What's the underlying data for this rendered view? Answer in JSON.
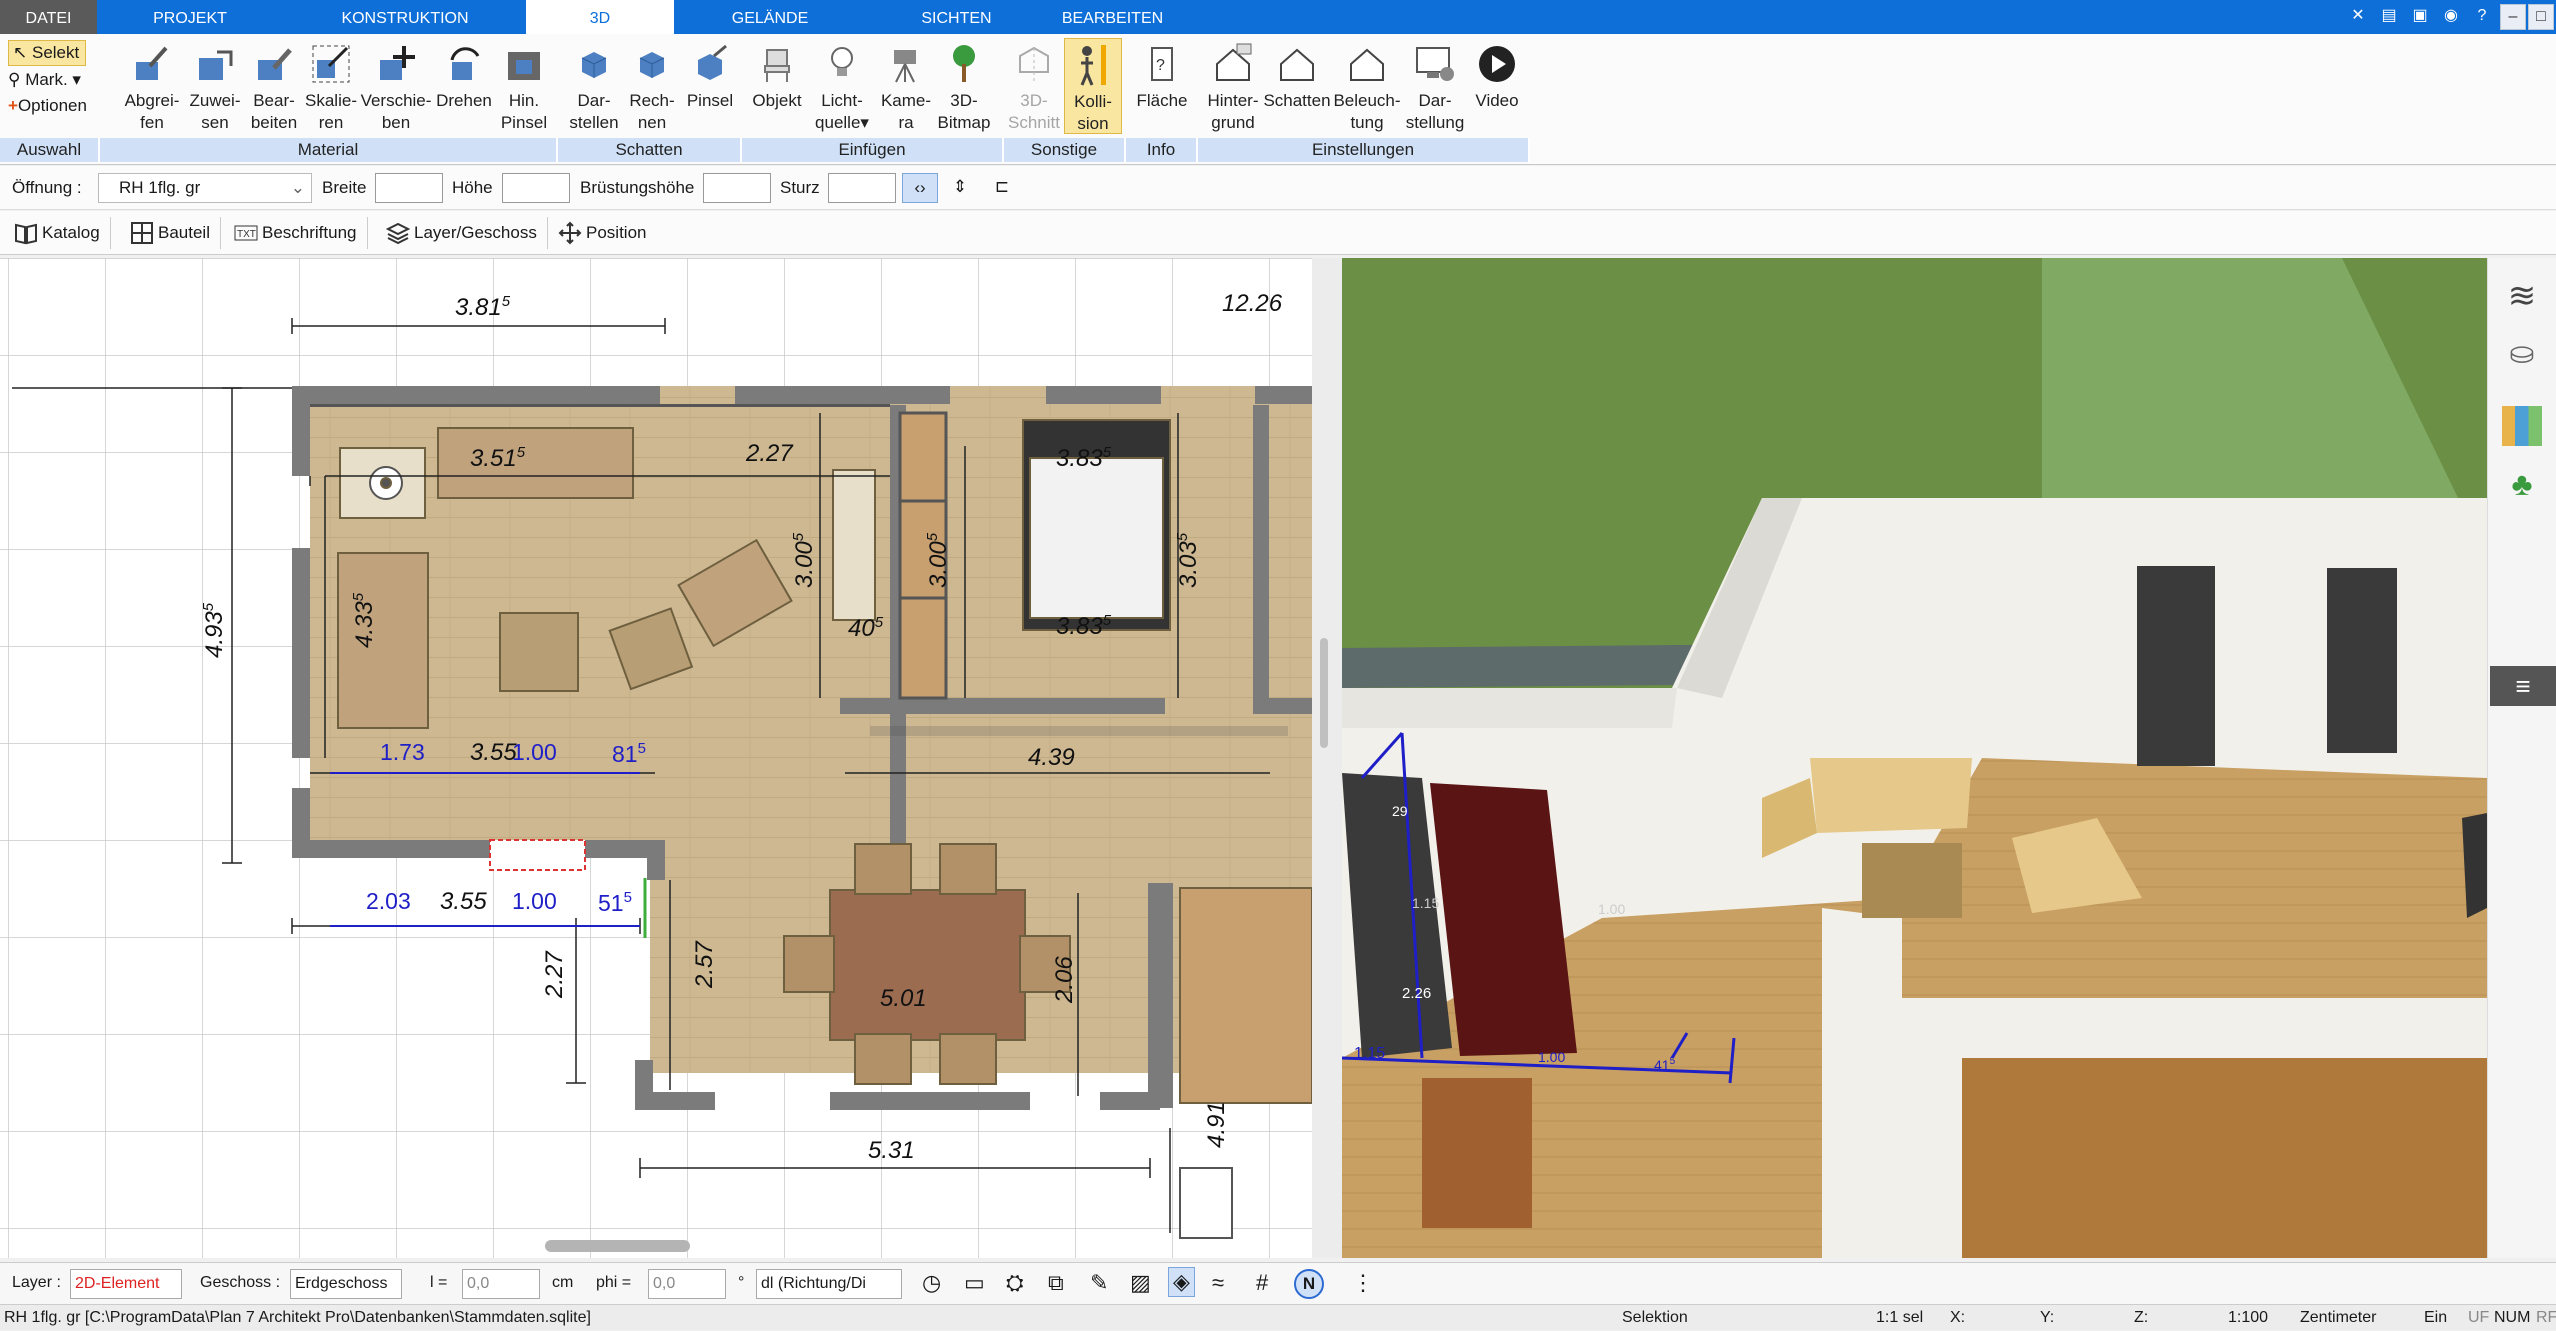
{
  "tabs": {
    "file": "DATEI",
    "projekt": "PROJEKT",
    "konstruktion": "KONSTRUKTION",
    "d3": "3D",
    "gelaende": "GELÄNDE",
    "sichten": "SICHTEN",
    "bearbeiten": "BEARBEITEN"
  },
  "auswahl": {
    "selekt": "Selekt",
    "mark": "Mark.",
    "optionen": "Optionen",
    "group": "Auswahl"
  },
  "material": {
    "group": "Material",
    "b1": [
      "Abgrei-",
      "fen"
    ],
    "b2": [
      "Zuwei-",
      "sen"
    ],
    "b3": [
      "Bear-",
      "beiten"
    ],
    "b4": [
      "Skalie-",
      "ren"
    ],
    "b5": [
      "Verschie-",
      "ben"
    ],
    "b6": [
      "Drehen",
      ""
    ],
    "b7": [
      "Hin.",
      "Pinsel"
    ]
  },
  "schatten": {
    "group": "Schatten",
    "b1": [
      "Dar-",
      "stellen"
    ],
    "b2": [
      "Rech-",
      "nen"
    ],
    "b3": [
      "Pinsel",
      ""
    ]
  },
  "einfuegen": {
    "group": "Einfügen",
    "b1": [
      "Objekt",
      ""
    ],
    "b2": [
      "Licht-",
      "quelle"
    ],
    "b3": [
      "Kame-",
      "ra"
    ],
    "b4": [
      "3D-",
      "Bitmap"
    ]
  },
  "sonstige": {
    "group": "Sonstige",
    "b1": [
      "3D-",
      "Schnitt"
    ],
    "b2": [
      "Kolli-",
      "sion"
    ]
  },
  "info": {
    "group": "Info",
    "b1": "Fläche"
  },
  "einstellungen": {
    "group": "Einstellungen",
    "b1": [
      "Hinter-",
      "grund"
    ],
    "b2": [
      "Schatten",
      ""
    ],
    "b3": [
      "Beleuch-",
      "tung"
    ],
    "b4": [
      "Dar-",
      "stellung"
    ],
    "b5": [
      "Video",
      ""
    ]
  },
  "optbar": {
    "oeffnung": "Öffnung :",
    "name": "RH 1flg. gr",
    "breite": "Breite",
    "hoehe": "Höhe",
    "bruestung": "Brüstungshöhe",
    "sturz": "Sturz"
  },
  "toolbar2": {
    "katalog": "Katalog",
    "bauteil": "Bauteil",
    "beschriftung": "Beschriftung",
    "layer": "Layer/Geschoss",
    "position": "Position"
  },
  "plan_dims": {
    "d1": "3.81",
    "d1s": "5",
    "d2": "12.26",
    "d3": "3.51",
    "d3s": "5",
    "d4": "2.27",
    "d5": "3.83",
    "d5s": "5",
    "d6": "4.93",
    "d6s": "5",
    "d7": "4.33",
    "d7s": "5",
    "d8": "3.00",
    "d8s": "5",
    "d9": "3.00",
    "d9s": "5",
    "d10": "3.03",
    "d10s": "5",
    "d11": "40",
    "d11s": "5",
    "d12": "3.83",
    "d12s": "5",
    "d13": "1.73",
    "d14": "3.55",
    "d15": "1.00",
    "d16": "81",
    "d16s": "5",
    "d17": "4.39",
    "d18": "2.03",
    "d19": "3.55",
    "d20": "1.00",
    "d21": "51",
    "d21s": "5",
    "d22": "2.27",
    "d23": "2.57",
    "d24": "5.01",
    "d25": "2.06",
    "d26": "5.31",
    "d27": "4.91"
  },
  "view3d_dims": {
    "a": "29",
    "b": "1.15",
    "c": "2.26",
    "d": "1.15",
    "e": "1.00",
    "f": "41",
    "fs": "5",
    "g": "1.00"
  },
  "bottombar": {
    "layer_label": "Layer :",
    "layer_value": "2D-Element",
    "geschoss_label": "Geschoss :",
    "geschoss_value": "Erdgeschoss",
    "l_label": "l =",
    "l_value": "0,0",
    "l_unit": "cm",
    "phi_label": "phi =",
    "phi_value": "0,0",
    "phi_unit": "°",
    "dl_value": "dl (Richtung/Di"
  },
  "status": {
    "file": "RH 1flg. gr [C:\\ProgramData\\Plan 7 Architekt Pro\\Datenbanken\\Stammdaten.sqlite]",
    "mode": "Selektion",
    "sel": "1:1 sel",
    "x": "X:",
    "y": "Y:",
    "z": "Z:",
    "scale": "1:100",
    "unit": "Zentimeter",
    "ein": "Ein",
    "uf": "UF",
    "num": "NUM",
    "rf": "RF"
  },
  "colors": {
    "accent": "#0e6fd8",
    "wall": "#7c7c7c",
    "floor": "#cbb690",
    "dim_blue": "#1f1fc8"
  }
}
